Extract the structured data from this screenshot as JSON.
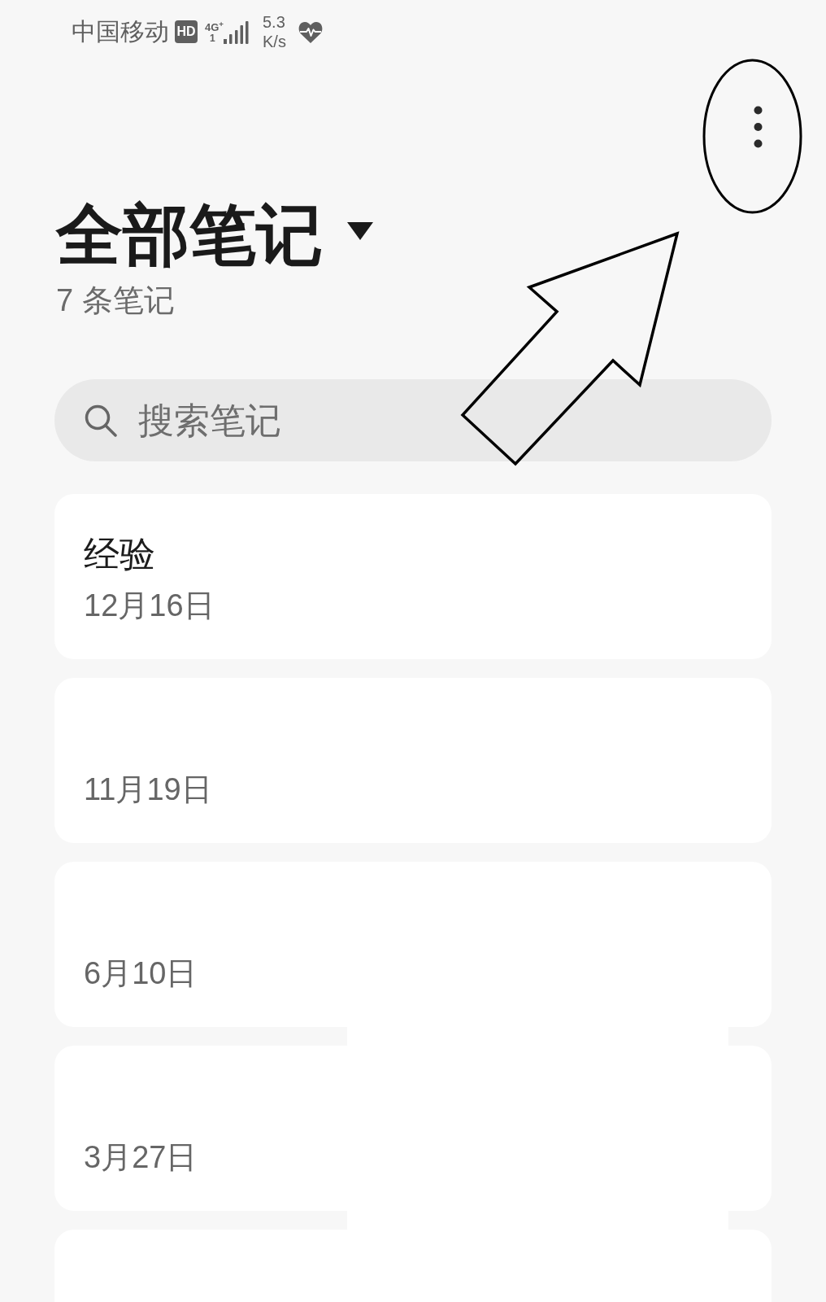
{
  "status_bar": {
    "carrier": "中国移动",
    "hd_badge": "HD",
    "network_type": "4G$^{+}$",
    "sim_slot": "1",
    "speed_value": "5.3",
    "speed_unit": "K/s"
  },
  "header": {
    "title": "全部笔记",
    "note_count": "7 条笔记"
  },
  "search": {
    "placeholder": "搜索笔记"
  },
  "notes": [
    {
      "title": "经验",
      "date": "12月16日"
    },
    {
      "date": "11月19日"
    },
    {
      "date": "6月10日"
    },
    {
      "date": "3月27日"
    }
  ],
  "notes_more_below": true,
  "annotations": [
    {
      "kind": "ellipse"
    },
    {
      "kind": "arrow"
    },
    {
      "kind": "patch"
    }
  ]
}
